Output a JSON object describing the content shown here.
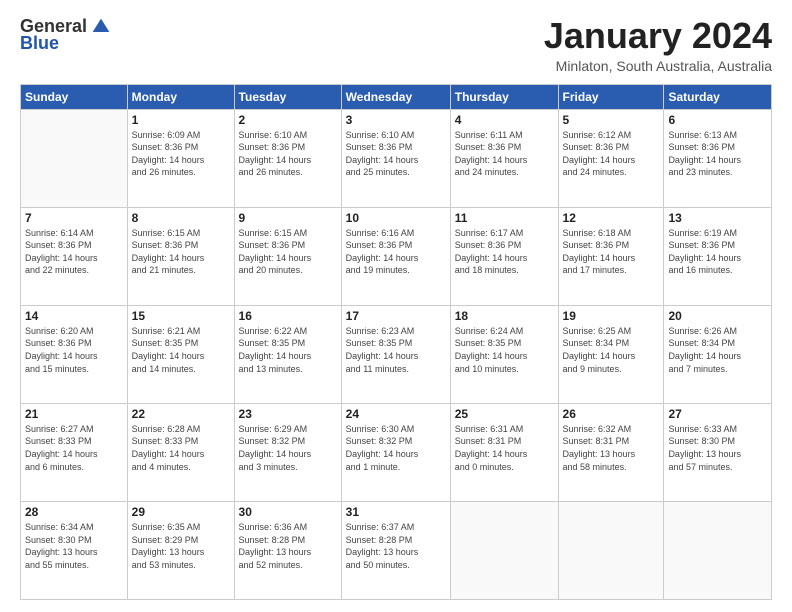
{
  "header": {
    "logo_general": "General",
    "logo_blue": "Blue",
    "title": "January 2024",
    "subtitle": "Minlaton, South Australia, Australia"
  },
  "days_of_week": [
    "Sunday",
    "Monday",
    "Tuesday",
    "Wednesday",
    "Thursday",
    "Friday",
    "Saturday"
  ],
  "weeks": [
    [
      {
        "day": "",
        "info": ""
      },
      {
        "day": "1",
        "info": "Sunrise: 6:09 AM\nSunset: 8:36 PM\nDaylight: 14 hours\nand 26 minutes."
      },
      {
        "day": "2",
        "info": "Sunrise: 6:10 AM\nSunset: 8:36 PM\nDaylight: 14 hours\nand 26 minutes."
      },
      {
        "day": "3",
        "info": "Sunrise: 6:10 AM\nSunset: 8:36 PM\nDaylight: 14 hours\nand 25 minutes."
      },
      {
        "day": "4",
        "info": "Sunrise: 6:11 AM\nSunset: 8:36 PM\nDaylight: 14 hours\nand 24 minutes."
      },
      {
        "day": "5",
        "info": "Sunrise: 6:12 AM\nSunset: 8:36 PM\nDaylight: 14 hours\nand 24 minutes."
      },
      {
        "day": "6",
        "info": "Sunrise: 6:13 AM\nSunset: 8:36 PM\nDaylight: 14 hours\nand 23 minutes."
      }
    ],
    [
      {
        "day": "7",
        "info": "Sunrise: 6:14 AM\nSunset: 8:36 PM\nDaylight: 14 hours\nand 22 minutes."
      },
      {
        "day": "8",
        "info": "Sunrise: 6:15 AM\nSunset: 8:36 PM\nDaylight: 14 hours\nand 21 minutes."
      },
      {
        "day": "9",
        "info": "Sunrise: 6:15 AM\nSunset: 8:36 PM\nDaylight: 14 hours\nand 20 minutes."
      },
      {
        "day": "10",
        "info": "Sunrise: 6:16 AM\nSunset: 8:36 PM\nDaylight: 14 hours\nand 19 minutes."
      },
      {
        "day": "11",
        "info": "Sunrise: 6:17 AM\nSunset: 8:36 PM\nDaylight: 14 hours\nand 18 minutes."
      },
      {
        "day": "12",
        "info": "Sunrise: 6:18 AM\nSunset: 8:36 PM\nDaylight: 14 hours\nand 17 minutes."
      },
      {
        "day": "13",
        "info": "Sunrise: 6:19 AM\nSunset: 8:36 PM\nDaylight: 14 hours\nand 16 minutes."
      }
    ],
    [
      {
        "day": "14",
        "info": "Sunrise: 6:20 AM\nSunset: 8:36 PM\nDaylight: 14 hours\nand 15 minutes."
      },
      {
        "day": "15",
        "info": "Sunrise: 6:21 AM\nSunset: 8:35 PM\nDaylight: 14 hours\nand 14 minutes."
      },
      {
        "day": "16",
        "info": "Sunrise: 6:22 AM\nSunset: 8:35 PM\nDaylight: 14 hours\nand 13 minutes."
      },
      {
        "day": "17",
        "info": "Sunrise: 6:23 AM\nSunset: 8:35 PM\nDaylight: 14 hours\nand 11 minutes."
      },
      {
        "day": "18",
        "info": "Sunrise: 6:24 AM\nSunset: 8:35 PM\nDaylight: 14 hours\nand 10 minutes."
      },
      {
        "day": "19",
        "info": "Sunrise: 6:25 AM\nSunset: 8:34 PM\nDaylight: 14 hours\nand 9 minutes."
      },
      {
        "day": "20",
        "info": "Sunrise: 6:26 AM\nSunset: 8:34 PM\nDaylight: 14 hours\nand 7 minutes."
      }
    ],
    [
      {
        "day": "21",
        "info": "Sunrise: 6:27 AM\nSunset: 8:33 PM\nDaylight: 14 hours\nand 6 minutes."
      },
      {
        "day": "22",
        "info": "Sunrise: 6:28 AM\nSunset: 8:33 PM\nDaylight: 14 hours\nand 4 minutes."
      },
      {
        "day": "23",
        "info": "Sunrise: 6:29 AM\nSunset: 8:32 PM\nDaylight: 14 hours\nand 3 minutes."
      },
      {
        "day": "24",
        "info": "Sunrise: 6:30 AM\nSunset: 8:32 PM\nDaylight: 14 hours\nand 1 minute."
      },
      {
        "day": "25",
        "info": "Sunrise: 6:31 AM\nSunset: 8:31 PM\nDaylight: 14 hours\nand 0 minutes."
      },
      {
        "day": "26",
        "info": "Sunrise: 6:32 AM\nSunset: 8:31 PM\nDaylight: 13 hours\nand 58 minutes."
      },
      {
        "day": "27",
        "info": "Sunrise: 6:33 AM\nSunset: 8:30 PM\nDaylight: 13 hours\nand 57 minutes."
      }
    ],
    [
      {
        "day": "28",
        "info": "Sunrise: 6:34 AM\nSunset: 8:30 PM\nDaylight: 13 hours\nand 55 minutes."
      },
      {
        "day": "29",
        "info": "Sunrise: 6:35 AM\nSunset: 8:29 PM\nDaylight: 13 hours\nand 53 minutes."
      },
      {
        "day": "30",
        "info": "Sunrise: 6:36 AM\nSunset: 8:28 PM\nDaylight: 13 hours\nand 52 minutes."
      },
      {
        "day": "31",
        "info": "Sunrise: 6:37 AM\nSunset: 8:28 PM\nDaylight: 13 hours\nand 50 minutes."
      },
      {
        "day": "",
        "info": ""
      },
      {
        "day": "",
        "info": ""
      },
      {
        "day": "",
        "info": ""
      }
    ]
  ]
}
